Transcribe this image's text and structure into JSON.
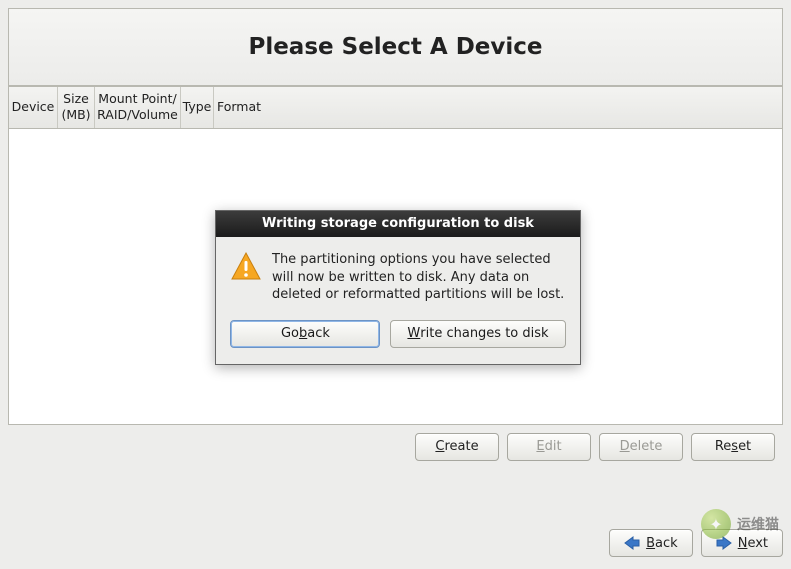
{
  "title": "Please Select A Device",
  "columns": {
    "device": "Device",
    "size": "Size\n(MB)",
    "mount": "Mount Point/\nRAID/Volume",
    "type": "Type",
    "format": "Format"
  },
  "buttons": {
    "create": "Create",
    "edit": "Edit",
    "delete": "Delete",
    "reset": "Reset",
    "back": "Back",
    "next": "Next"
  },
  "mnemonics": {
    "create": "C",
    "edit": "E",
    "delete": "D",
    "reset": "s",
    "back": "B",
    "next": "N"
  },
  "dialog": {
    "title": "Writing storage configuration to disk",
    "message": "The partitioning options you have selected will now be written to disk.  Any data on deleted or reformatted partitions will be lost.",
    "go_back": "Go back",
    "go_back_mn": "b",
    "write": "Write changes to disk",
    "write_mn": "W"
  },
  "watermark": "运维猫"
}
